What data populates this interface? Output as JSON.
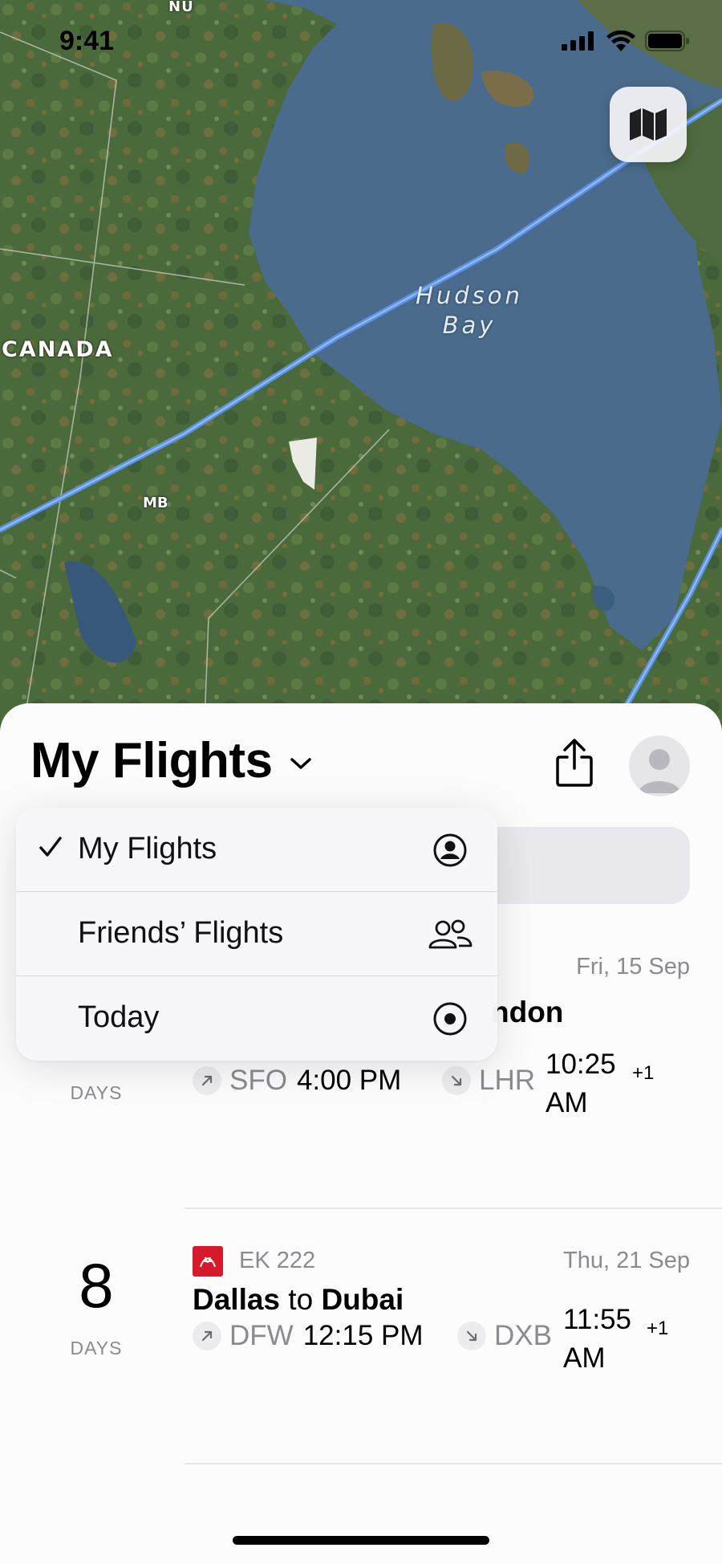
{
  "status_bar": {
    "time": "9:41"
  },
  "map": {
    "labels": {
      "nu": "NU",
      "canada": "CANADA",
      "mb": "MB",
      "hudson_bay": "Hudson\nBay"
    },
    "mode_button_icon": "map-icon"
  },
  "sheet": {
    "title": "My Flights",
    "share_icon": "share-icon",
    "avatar_icon": "person-icon"
  },
  "dropdown": {
    "items": [
      {
        "label": "My Flights",
        "selected": true,
        "icon": "person-circle-icon"
      },
      {
        "label": "Friends’ Flights",
        "selected": false,
        "icon": "two-people-icon"
      },
      {
        "label": "Today",
        "selected": false,
        "icon": "target-icon"
      }
    ]
  },
  "flights": [
    {
      "days": "",
      "days_label": "DAYS",
      "flight_no": "",
      "date": "Fri, 15 Sep",
      "route_to": "ndon",
      "dep_code": "SFO",
      "dep_time": "4:00 PM",
      "arr_code": "LHR",
      "arr_time": "10:25\nAM",
      "arr_offset": "+1"
    },
    {
      "days": "8",
      "days_label": "DAYS",
      "airline": "Emirates",
      "flight_no": "EK 222",
      "date": "Thu, 21 Sep",
      "route_from": "Dallas",
      "route_mid": "to",
      "route_to": "Dubai",
      "dep_code": "DFW",
      "dep_time": "12:15 PM",
      "arr_code": "DXB",
      "arr_time": "11:55\nAM",
      "arr_offset": "+1"
    }
  ],
  "colors": {
    "water": "#4a6b8c",
    "route": "#5b96f0",
    "emirates_red": "#d7192c"
  }
}
